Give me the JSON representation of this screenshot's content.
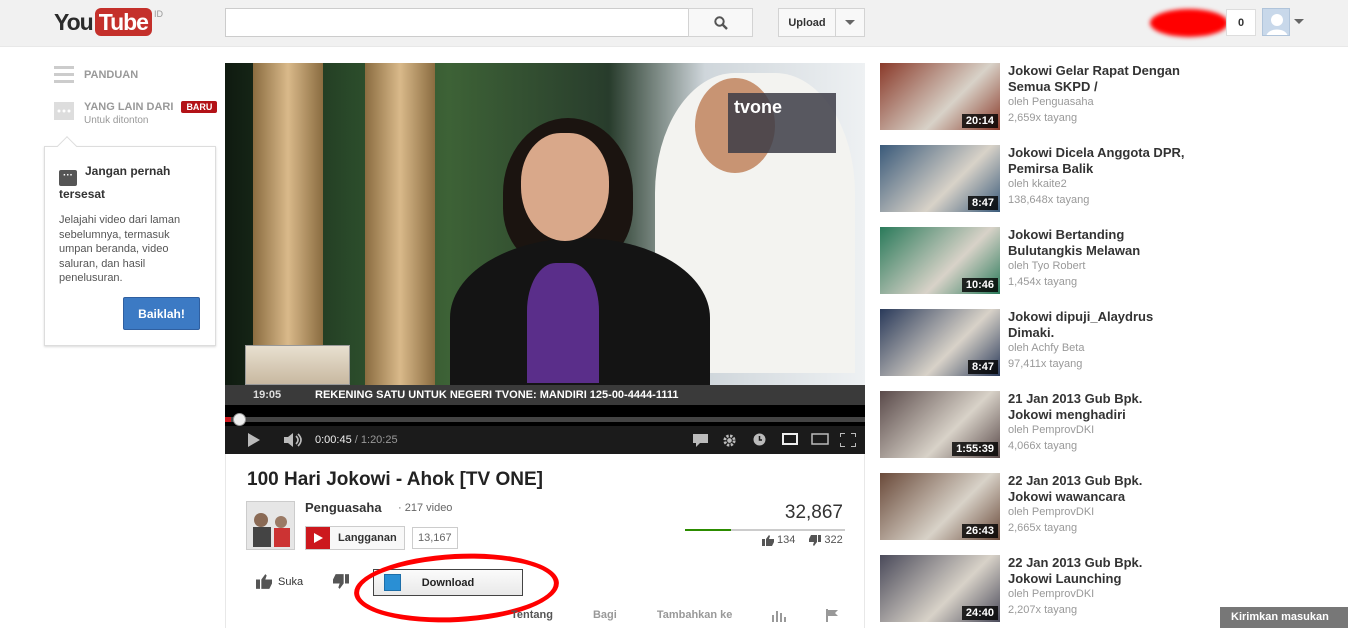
{
  "masthead": {
    "logo_you": "You",
    "logo_tube": "Tube",
    "logo_region": "ID",
    "search_placeholder": "",
    "upload_label": "Upload",
    "notification_count": "0"
  },
  "guide": {
    "panduan_label": "PANDUAN",
    "yang_lain_label": "YANG LAIN DARI",
    "yang_lain_sub": "Untuk ditonton",
    "baru_badge": "BARU"
  },
  "tooltip": {
    "title": "Jangan pernah tersesat",
    "body": "Jelajahi video dari laman sebelumnya, termasuk umpan beranda, video saluran, dan hasil penelusuran.",
    "button": "Baiklah!"
  },
  "player": {
    "ticker_time": "19:05",
    "ticker_text": "REKENING SATU UNTUK NEGERI TVONE: MANDIRI 125-00-4444-1111",
    "tv_logo": "tvone",
    "current_time": "0:00:45",
    "duration": "1:20:25",
    "progress": 0.01
  },
  "video": {
    "title": "100 Hari Jokowi - Ahok [TV ONE]",
    "owner": "Penguasaha",
    "owner_video_count": "· 217 video",
    "subscribe_label": "Langganan",
    "subscriber_count": "13,167",
    "views": "32,867",
    "likes": "134",
    "dislikes": "322",
    "like_ratio": 0.29,
    "like_label": "Suka",
    "download_label": "Download",
    "tabs": [
      "Tentang",
      "Bagi",
      "Tambahkan ke"
    ]
  },
  "recommendations": [
    {
      "title": "Jokowi Gelar Rapat Dengan Semua SKPD /",
      "owner": "oleh Penguasaha",
      "views": "2,659x tayang",
      "duration": "20:14",
      "thumb_color": "#8a3a2a"
    },
    {
      "title": "Jokowi Dicela Anggota DPR, Pemirsa Balik",
      "owner": "oleh kkaite2",
      "views": "138,648x tayang",
      "duration": "8:47",
      "thumb_color": "#3a5a7a"
    },
    {
      "title": "Jokowi Bertanding Bulutangkis Melawan",
      "owner": "oleh Tyo Robert",
      "views": "1,454x tayang",
      "duration": "10:46",
      "thumb_color": "#2a7a5a"
    },
    {
      "title": "Jokowi dipuji_Alaydrus Dimaki.",
      "owner": "oleh Achfy Beta",
      "views": "97,411x tayang",
      "duration": "8:47",
      "thumb_color": "#2a3a5a"
    },
    {
      "title": "21 Jan 2013 Gub Bpk. Jokowi menghadiri",
      "owner": "oleh PemprovDKI",
      "views": "4,066x tayang",
      "duration": "1:55:39",
      "thumb_color": "#5a4a4a"
    },
    {
      "title": "22 Jan 2013 Gub Bpk. Jokowi wawancara",
      "owner": "oleh PemprovDKI",
      "views": "2,665x tayang",
      "duration": "26:43",
      "thumb_color": "#6a4a3a"
    },
    {
      "title": "22 Jan 2013 Gub Bpk. Jokowi Launching",
      "owner": "oleh PemprovDKI",
      "views": "2,207x tayang",
      "duration": "24:40",
      "thumb_color": "#4a4a5a"
    }
  ],
  "feedback_label": "Kirimkan masukan"
}
